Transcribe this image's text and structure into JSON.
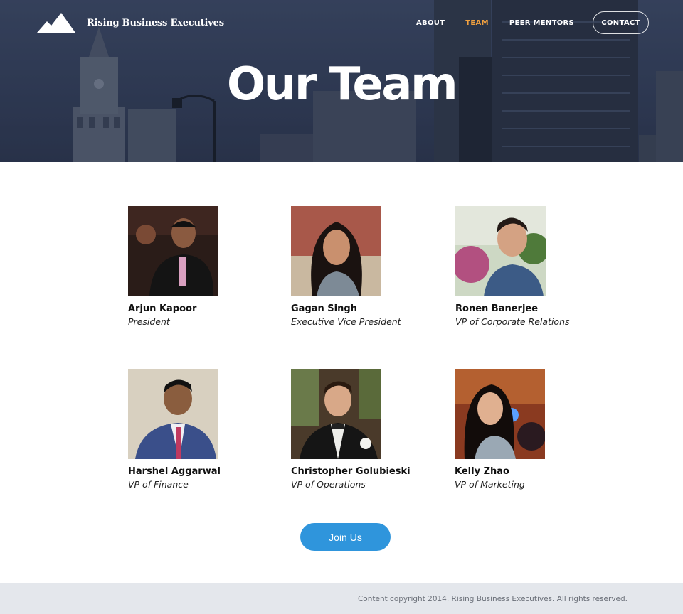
{
  "brand": {
    "name": "Rising Business Executives",
    "logo_icon": "mountain-icon"
  },
  "nav": {
    "items": [
      {
        "label": "ABOUT",
        "active": false
      },
      {
        "label": "TEAM",
        "active": true
      },
      {
        "label": "PEER MENTORS",
        "active": false
      }
    ],
    "contact_label": "CONTACT"
  },
  "hero": {
    "title": "Our Team"
  },
  "team": [
    {
      "name": "Arjun Kapoor",
      "role": "President"
    },
    {
      "name": "Gagan Singh",
      "role": "Executive Vice President"
    },
    {
      "name": "Ronen Banerjee",
      "role": "VP of Corporate Relations"
    },
    {
      "name": "Harshel Aggarwal",
      "role": "VP of Finance"
    },
    {
      "name": "Christopher Golubieski",
      "role": "VP of Operations"
    },
    {
      "name": "Kelly Zhao",
      "role": "VP of Marketing"
    }
  ],
  "cta": {
    "label": "Join Us"
  },
  "footer": {
    "text": "Content copyright 2014. Rising Business Executives. All rights reserved."
  },
  "colors": {
    "accent": "#f0a040",
    "button": "#2f95dc",
    "footer_bg": "#e4e7ec"
  }
}
